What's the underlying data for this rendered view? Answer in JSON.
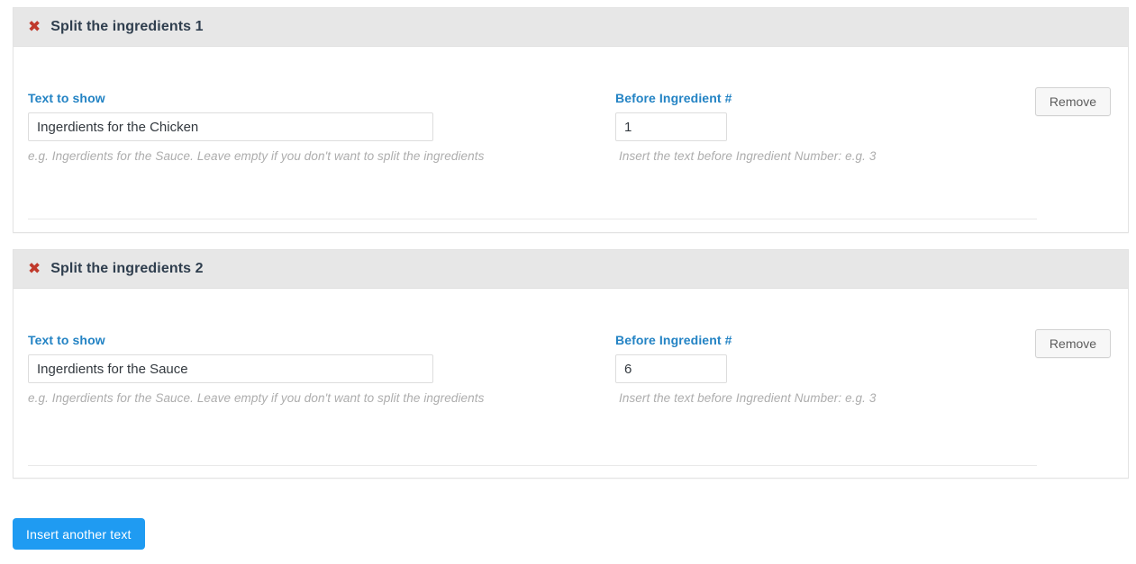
{
  "colors": {
    "accent_blue": "#2383c4",
    "primary_button": "#1f9bf2",
    "close_red": "#c0392b",
    "header_gray": "#e7e7e7",
    "hint_gray": "#adadad"
  },
  "panels": [
    {
      "close_icon": "✖",
      "title": "Split the ingredients 1",
      "text_field": {
        "label": "Text to show",
        "value": "Ingerdients for the Chicken",
        "placeholder": "",
        "hint": "e.g. Ingerdients for the Sauce. Leave empty if you don't want to split the ingredients"
      },
      "number_field": {
        "label": "Before Ingredient #",
        "value": "1",
        "placeholder": "",
        "hint": "Insert the text before Ingredient Number: e.g. 3"
      },
      "remove_label": "Remove"
    },
    {
      "close_icon": "✖",
      "title": "Split the ingredients 2",
      "text_field": {
        "label": "Text to show",
        "value": "Ingerdients for the Sauce",
        "placeholder": "",
        "hint": "e.g. Ingerdients for the Sauce. Leave empty if you don't want to split the ingredients"
      },
      "number_field": {
        "label": "Before Ingredient #",
        "value": "6",
        "placeholder": "",
        "hint": "Insert the text before Ingredient Number: e.g. 3"
      },
      "remove_label": "Remove"
    }
  ],
  "footer": {
    "insert_label": "Insert another text"
  }
}
